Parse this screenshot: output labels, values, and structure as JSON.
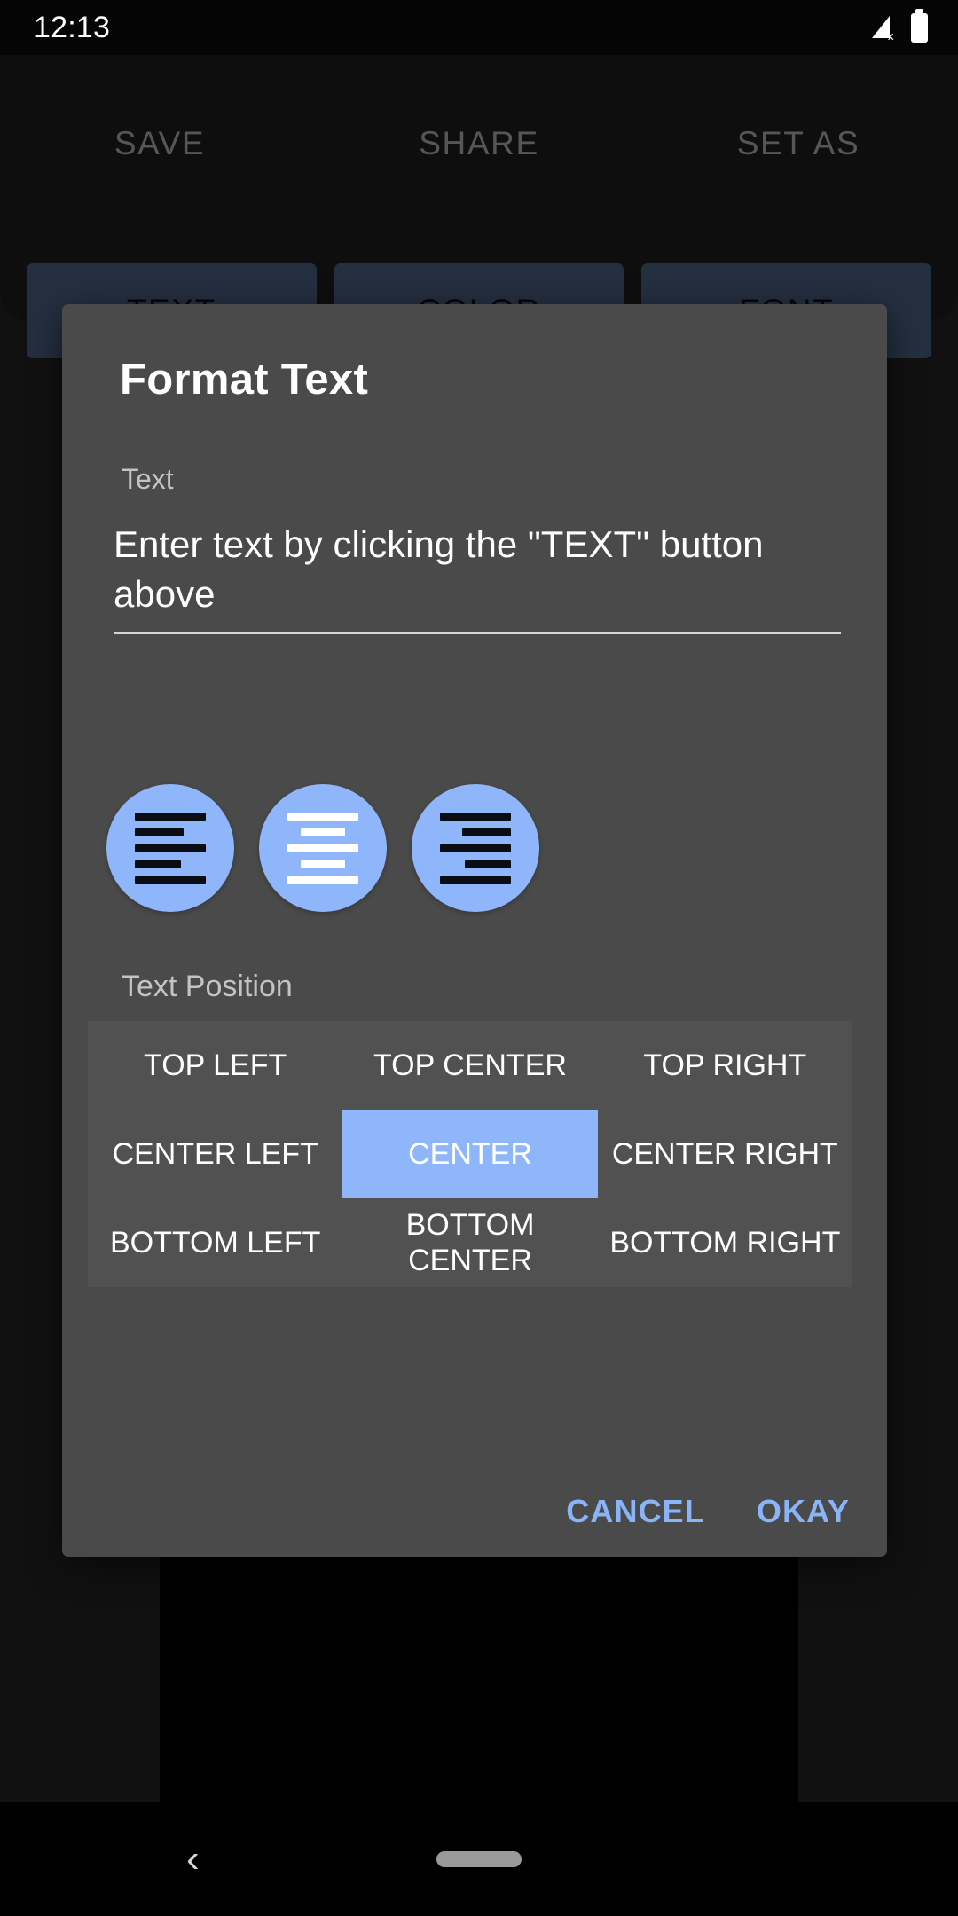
{
  "status_bar": {
    "time": "12:13",
    "signal_icon": "signal-no-sim-icon",
    "battery_icon": "battery-full-icon"
  },
  "editor": {
    "top_actions": [
      {
        "label": "SAVE",
        "name": "save-action"
      },
      {
        "label": "SHARE",
        "name": "share-action"
      },
      {
        "label": "SET AS",
        "name": "set-as-action"
      }
    ],
    "tool_buttons": [
      {
        "label": "TEXT",
        "name": "text-tool-button"
      },
      {
        "label": "COLOR",
        "name": "color-tool-button"
      },
      {
        "label": "FONT",
        "name": "font-tool-button"
      }
    ]
  },
  "dialog": {
    "title": "Format Text",
    "text_field": {
      "label": "Text",
      "value": "Enter text by clicking the \"TEXT\" button above"
    },
    "alignment": {
      "options": [
        {
          "name": "align-left-icon",
          "label": "Align Left",
          "selected": false
        },
        {
          "name": "align-center-icon",
          "label": "Align Center",
          "selected": true
        },
        {
          "name": "align-right-icon",
          "label": "Align Right",
          "selected": false
        }
      ]
    },
    "text_position": {
      "label": "Text Position",
      "cells": [
        {
          "label": "TOP LEFT",
          "selected": false
        },
        {
          "label": "TOP CENTER",
          "selected": false
        },
        {
          "label": "TOP RIGHT",
          "selected": false
        },
        {
          "label": "CENTER LEFT",
          "selected": false
        },
        {
          "label": "CENTER",
          "selected": true
        },
        {
          "label": "CENTER RIGHT",
          "selected": false
        },
        {
          "label": "BOTTOM LEFT",
          "selected": false
        },
        {
          "label": "BOTTOM CENTER",
          "selected": false
        },
        {
          "label": "BOTTOM RIGHT",
          "selected": false
        }
      ],
      "selected": "CENTER"
    },
    "actions": {
      "cancel": "CANCEL",
      "okay": "OKAY"
    }
  },
  "nav_bar": {
    "back_icon": "chevron-left-icon",
    "home_indicator": "home-pill-icon"
  },
  "colors": {
    "accent": "#8fb5fb",
    "dialog_bg": "#4a4a4a",
    "tool_button_bg": "#3b4d68",
    "action_text": "#8ab4f8"
  }
}
